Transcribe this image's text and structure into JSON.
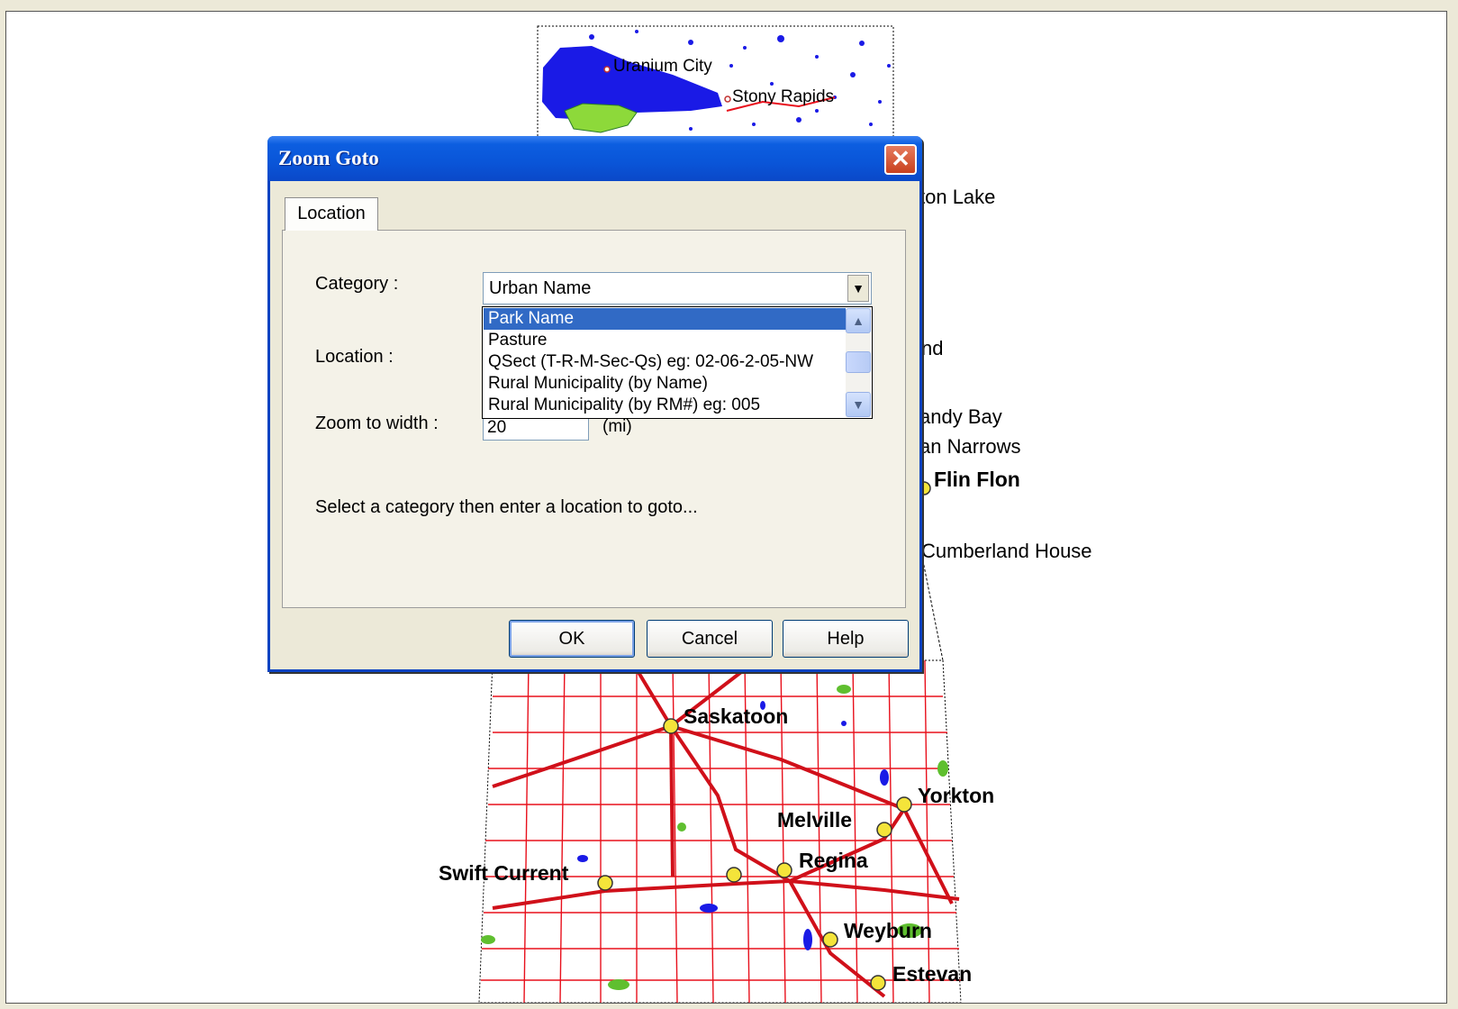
{
  "map": {
    "cities": [
      {
        "name": "Uranium City",
        "style": "small"
      },
      {
        "name": "Stony Rapids",
        "style": "small"
      },
      {
        "name": "ton Lake",
        "style": "normal"
      },
      {
        "name": "nd",
        "style": "normal"
      },
      {
        "name": "andy Bay",
        "style": "normal"
      },
      {
        "name": "an Narrows",
        "style": "normal"
      },
      {
        "name": "Flin Flon",
        "style": "major"
      },
      {
        "name": "Cumberland House",
        "style": "normal"
      },
      {
        "name": "Saskatoon",
        "style": "major"
      },
      {
        "name": "Yorkton",
        "style": "major"
      },
      {
        "name": "Melville",
        "style": "major"
      },
      {
        "name": "Swift Current",
        "style": "major"
      },
      {
        "name": "Regina",
        "style": "major"
      },
      {
        "name": "Weyburn",
        "style": "major"
      },
      {
        "name": "Estevan",
        "style": "major"
      }
    ],
    "colors": {
      "roads": "#e8101c",
      "water": "#1a1ae6",
      "parks": "#5fbf2f",
      "city_dot": "#f4e43a"
    }
  },
  "dialog": {
    "title": "Zoom Goto",
    "close_symbol": "✕",
    "tab_label": "Location",
    "category_label": "Category :",
    "category_value": "Urban Name",
    "location_label": "Location :",
    "zoom_label": "Zoom to width :",
    "zoom_value": "20",
    "zoom_unit": "(mi)",
    "hint": "Select a category then enter a location to goto...",
    "dropdown_items": [
      "Park Name",
      "Pasture",
      "QSect (T-R-M-Sec-Qs) eg: 02-06-2-05-NW",
      "Rural Municipality (by Name)",
      "Rural Municipality (by RM#) eg: 005"
    ],
    "selected_index": 0,
    "buttons": {
      "ok": "OK",
      "cancel": "Cancel",
      "help": "Help"
    }
  }
}
